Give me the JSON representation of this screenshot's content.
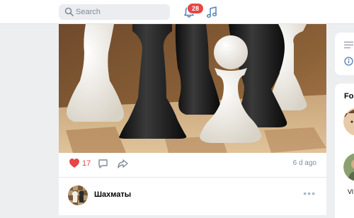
{
  "header": {
    "search_placeholder": "Search",
    "notifications_count": "28"
  },
  "post": {
    "likes": "17",
    "time": "6 d ago"
  },
  "next_post": {
    "group_name": "Шахматы"
  },
  "sidebar": {
    "section_label": "Fol",
    "person_name": "Vl"
  },
  "colors": {
    "accent_red": "#e64646",
    "icon_blue": "#5181b8",
    "background": "#edeef0"
  }
}
